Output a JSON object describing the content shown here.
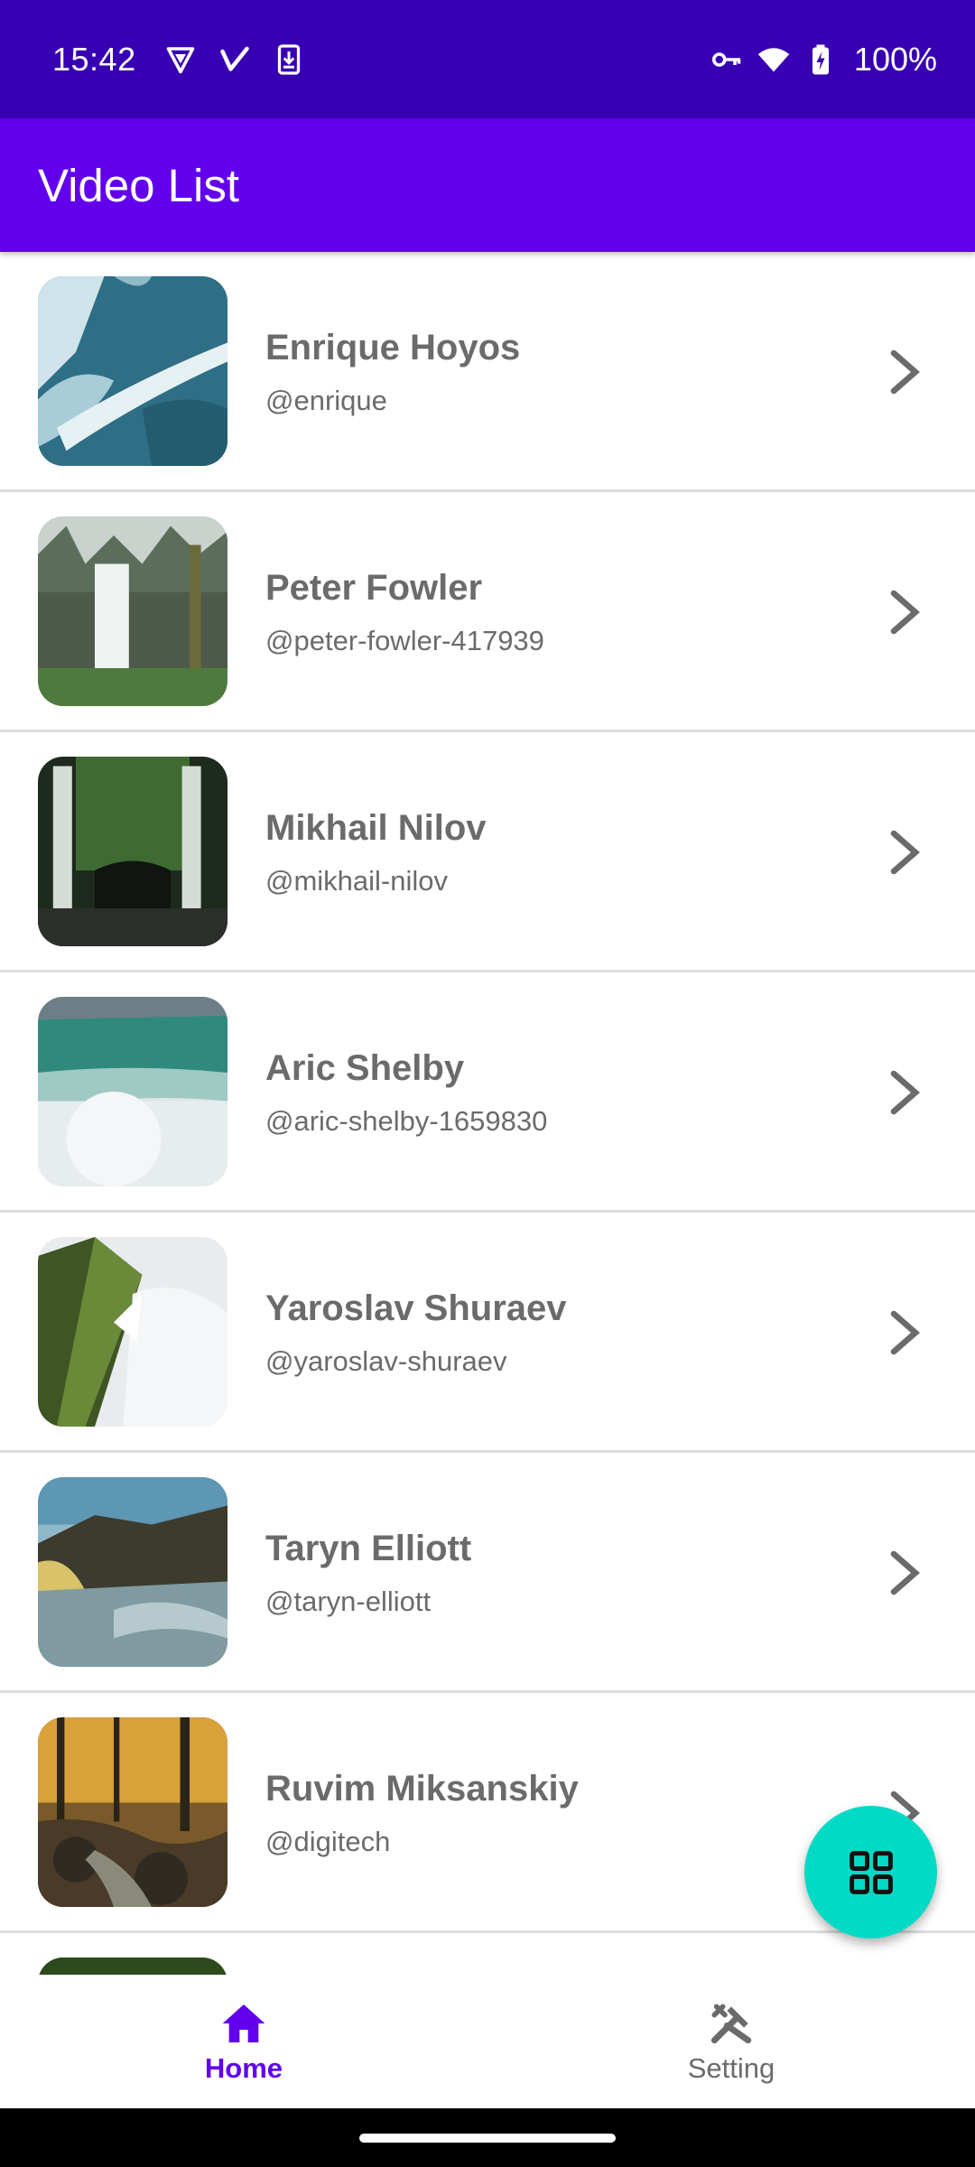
{
  "status_bar": {
    "time": "15:42",
    "battery_percent": "100%",
    "icons_left": [
      "vpn-shield-icon",
      "v-app-icon",
      "download-icon"
    ],
    "icons_right": [
      "key-icon",
      "wifi-icon",
      "battery-charging-icon"
    ]
  },
  "app_bar": {
    "title": "Video List"
  },
  "videos": [
    {
      "name": "Enrique Hoyos",
      "handle": "@enrique"
    },
    {
      "name": "Peter Fowler",
      "handle": "@peter-fowler-417939"
    },
    {
      "name": "Mikhail Nilov",
      "handle": "@mikhail-nilov"
    },
    {
      "name": "Aric Shelby",
      "handle": "@aric-shelby-1659830"
    },
    {
      "name": "Yaroslav Shuraev",
      "handle": "@yaroslav-shuraev"
    },
    {
      "name": "Taryn Elliott",
      "handle": "@taryn-elliott"
    },
    {
      "name": "Ruvim Miksanskiy",
      "handle": "@digitech"
    }
  ],
  "fab": {
    "icon": "grid-icon",
    "color": "#03DAC5"
  },
  "bottom_nav": {
    "items": [
      {
        "label": "Home",
        "icon": "home-icon",
        "active": true
      },
      {
        "label": "Setting",
        "icon": "tools-icon",
        "active": false
      }
    ]
  },
  "colors": {
    "status_bar": "#3700B3",
    "primary": "#6200EE",
    "accent": "#03DAC5",
    "text_secondary": "#6b6b6b"
  }
}
